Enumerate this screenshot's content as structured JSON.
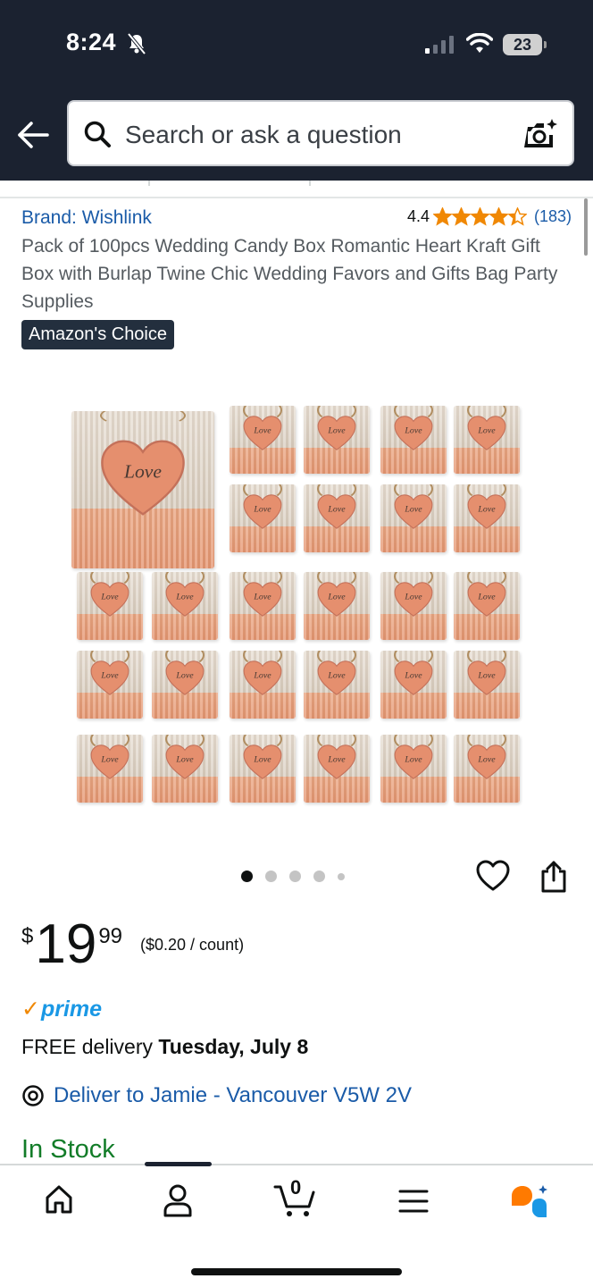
{
  "status_bar": {
    "time": "8:24",
    "battery": "23"
  },
  "search": {
    "placeholder": "Search or ask a question"
  },
  "product": {
    "brand": "Brand: Wishlink",
    "rating": "4.4",
    "rating_stars": 4.4,
    "review_count": "(183)",
    "title": "Pack of 100pcs Wedding Candy Box Romantic Heart Kraft Gift Box with Burlap Twine Chic Wedding Favors and Gifts Bag Party Supplies",
    "badge": "Amazon's Choice",
    "heart_label": "Love",
    "image_count": 5,
    "active_image": 1
  },
  "price": {
    "currency": "$",
    "whole": "19",
    "fraction": "99",
    "unit_price": "($0.20 / count)"
  },
  "prime": {
    "label": "prime",
    "check_icon": "prime-check-icon"
  },
  "delivery": {
    "prefix": "FREE delivery ",
    "date": "Tuesday, July 8"
  },
  "location": {
    "text": "Deliver to Jamie - Vancouver V5W 2V"
  },
  "stock": {
    "text": "In Stock"
  },
  "bottom_nav": {
    "items": [
      "home-icon",
      "account-icon",
      "cart-icon",
      "menu-icon",
      "rufus-icon"
    ],
    "cart_count": "0"
  },
  "colors": {
    "header": "#1b2230",
    "link": "#1a5ba8",
    "star": "#f08804",
    "stock": "#127c28",
    "prime": "#1a98e5"
  }
}
